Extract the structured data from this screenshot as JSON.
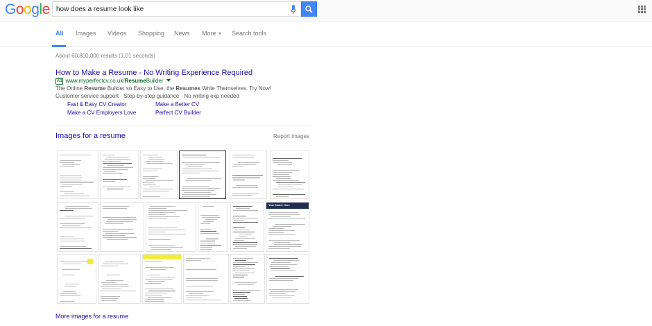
{
  "header": {
    "logo_letters": [
      {
        "char": "G",
        "color": "#4285f4"
      },
      {
        "char": "o",
        "color": "#ea4335"
      },
      {
        "char": "o",
        "color": "#fbbc05"
      },
      {
        "char": "g",
        "color": "#4285f4"
      },
      {
        "char": "l",
        "color": "#34a853"
      },
      {
        "char": "e",
        "color": "#ea4335"
      }
    ],
    "search_query": "how does a resume look like",
    "mic_icon": "microphone-icon",
    "search_icon": "magnifier-icon",
    "apps_icon": "apps-grid-icon",
    "accent_color": "#4285f4"
  },
  "tabs": {
    "all": "All",
    "images": "Images",
    "videos": "Videos",
    "shopping": "Shopping",
    "news": "News",
    "more": "More",
    "tools": "Search tools"
  },
  "stats": "About 60,800,000 results (1.01 seconds)",
  "ad": {
    "title": "How to Make a Resume - No Writing Experience Required",
    "badge": "Ad",
    "url_prefix": "www.myperfectcv.co.uk/",
    "url_bold": "Resume",
    "url_suffix": "Builder",
    "desc1_a": "The Online ",
    "desc1_b": "Resume",
    "desc1_c": " Builder so Easy to Use, the ",
    "desc1_d": "Resumes",
    "desc1_e": " Write Themselves. Try Now!",
    "desc2": "Customer service support · Step-by-step guidance · No writing exp needed",
    "sitelinks": [
      "Fast & Easy CV Creator",
      "Make a Better CV",
      "Make a CV Employers Love",
      "Perfect CV Builder"
    ]
  },
  "images": {
    "heading": "Images for a resume",
    "report": "Report images",
    "more": "More images for a resume",
    "thumb_name_text": "Your Name Here",
    "navy_color": "#1f2d4e",
    "highlight_color": "#f3ed3a"
  }
}
